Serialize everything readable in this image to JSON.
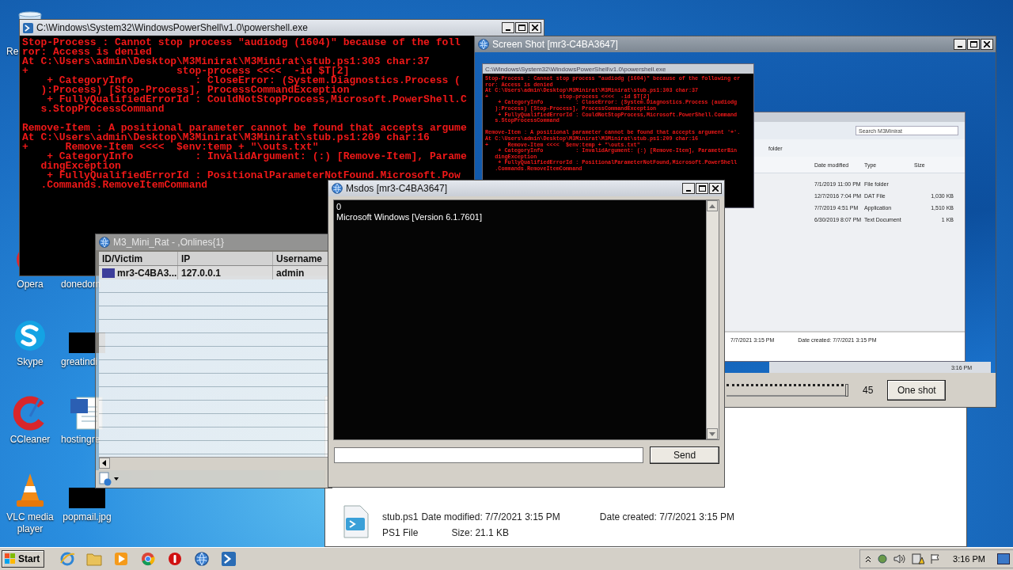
{
  "desktop_icons": [
    {
      "label": "Re",
      "kind": "recycle"
    },
    {
      "label": "Opera",
      "kind": "opera"
    },
    {
      "label": "Skype",
      "kind": "skype"
    },
    {
      "label": "CCleaner",
      "kind": "ccleaner"
    },
    {
      "label": "VLC media player",
      "kind": "vlc"
    },
    {
      "label": "donedom"
    },
    {
      "label": "greatindi",
      "kind": "thumbnail"
    },
    {
      "label": "hostingre",
      "kind": "word"
    },
    {
      "label": "popmail.jpg",
      "kind": "thumbnail"
    }
  ],
  "powershell": {
    "title": "C:\\Windows\\System32\\WindowsPowerShell\\v1.0\\powershell.exe",
    "blocks": [
      [
        "Stop-Process : Cannot stop process \"audiodg (1604)\" because of the foll",
        "ror: Access is denied",
        "At C:\\Users\\admin\\Desktop\\M3Minirat\\M3Minirat\\stub.ps1:303 char:37",
        "+                        stop-process <<<<  -id $T[2]",
        "    + CategoryInfo          : CloseError: (System.Diagnostics.Process (",
        "   ):Process) [Stop-Process], ProcessCommandException",
        "    + FullyQualifiedErrorId : CouldNotStopProcess,Microsoft.PowerShell.C",
        "   s.StopProcessCommand"
      ],
      [
        "Remove-Item : A positional parameter cannot be found that accepts argume",
        "At C:\\Users\\admin\\Desktop\\M3Minirat\\M3Minirat\\stub.ps1:209 char:16",
        "+      Remove-Item <<<<  $env:temp + \"\\outs.txt\"",
        "    + CategoryInfo          : InvalidArgument: (:) [Remove-Item], Parame",
        "   dingException",
        "    + FullyQualifiedErrorId : PositionalParameterNotFound.Microsoft.Pow",
        "   .Commands.RemoveItemCommand"
      ]
    ]
  },
  "screenshot_window": {
    "title": "Screen Shot [mr3-C4BA3647]",
    "inner_console": {
      "title": "C:\\Windows\\System32\\WindowsPowerShell\\v1.0\\powershell.exe",
      "blocks": [
        [
          "Stop-Process : Cannot stop process \"audiodg (1604)\" because of the following er",
          "ror: Access is denied",
          "At C:\\Users\\admin\\Desktop\\M3Minirat\\M3Minirat\\stub.ps1:303 char:37",
          "+                      stop-process <<<<  -id $T[2]",
          "    + CategoryInfo          : CloseError: (System.Diagnostics.Process (audiodg",
          "   ):Process) [Stop-Process], ProcessCommandException",
          "    + FullyQualifiedErrorId : CouldNotStopProcess,Microsoft.PowerShell.Command",
          "   s.StopProcessCommand"
        ],
        [
          "Remove-Item : A positional parameter cannot be found that accepts argument '+'.",
          "At C:\\Users\\admin\\Desktop\\M3Minirat\\M3Minirat\\stub.ps1:209 char:16",
          "+      Remove-Item <<<<  $env:temp + \"\\outs.txt\"",
          "    + CategoryInfo          : InvalidArgument: (:) [Remove-Item], ParameterBin",
          "   dingException",
          "    + FullyQualifiedErrorId : PositionalParameterNotFound,Microsoft.PowerShell",
          "   .Commands.RemoveItemCommand"
        ]
      ]
    },
    "inner_explorer": {
      "toolbar_label": "folder",
      "search_placeholder": "Search M3Minirat",
      "columns": [
        "Date modified",
        "Type",
        "Size"
      ],
      "rows": [
        {
          "cells": [
            "7/1/2019 11:00 PM",
            "File folder",
            ""
          ]
        },
        {
          "cells": [
            "12/7/2016 7:04 PM",
            "DAT File",
            "1,030 KB"
          ]
        },
        {
          "cells": [
            "7/7/2019 4:51 PM",
            "Application",
            "1,510 KB"
          ]
        },
        {
          "cells": [
            "6/30/2019 8:07 PM",
            "Text Document",
            "1 KB"
          ]
        }
      ],
      "details": [
        "7/7/2021 3:15 PM",
        "Date created: 7/7/2021 3:15 PM"
      ]
    },
    "inner_clock": "3:16 PM",
    "slider": {
      "level": 1
    },
    "reading": "45",
    "button": "One shot"
  },
  "rat": {
    "title": "M3_Mini_Rat - ,Onlines{1}",
    "columns": [
      "ID/Victim",
      "IP",
      "Username"
    ],
    "rows": [
      {
        "cells": [
          "mr3-C4BA3...",
          "127.0.0.1",
          "admin"
        ]
      }
    ]
  },
  "msdos": {
    "title": "Msdos [mr3-C4BA3647]",
    "output": [
      "0",
      "Microsoft Windows [Version 6.1.7601]"
    ],
    "send_button": "Send"
  },
  "file_details": {
    "name": "stub.ps1",
    "type": "PS1 File",
    "date_modified": "Date modified: 7/7/2021 3:15 PM",
    "date_created": "Date created: 7/7/2021 3:15 PM",
    "size": "Size: 21.1 KB"
  },
  "taskbar": {
    "start": "Start",
    "apps": [
      {
        "kind": "ie"
      },
      {
        "kind": "folder"
      },
      {
        "kind": "media"
      },
      {
        "kind": "chrome"
      },
      {
        "kind": "stop"
      },
      {
        "kind": "globe"
      },
      {
        "kind": "powershell"
      }
    ],
    "clock": "3:16 PM"
  }
}
